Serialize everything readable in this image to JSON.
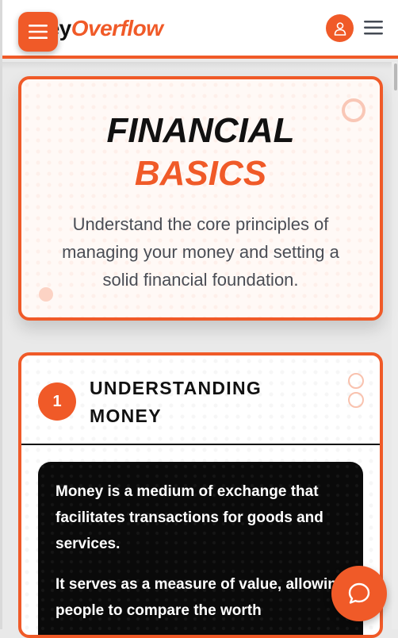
{
  "header": {
    "brand_part1": "ney",
    "brand_part2": "Overflow",
    "menu_button_icon": "hamburger-icon",
    "profile_icon": "user-icon",
    "nav_menu_icon": "hamburger-icon"
  },
  "hero": {
    "title_line1": "FINANCIAL",
    "title_line2": "BASICS",
    "description": "Understand the core principles of managing your money and setting a solid financial foundation."
  },
  "section": {
    "number": "1",
    "title": "UNDERSTANDING MONEY",
    "paragraphs": [
      "Money is a medium of exchange that facilitates transactions for goods and services.",
      "It serves as a measure of value, allowing people to compare the worth"
    ]
  },
  "chat": {
    "icon": "chat-bubble-icon"
  },
  "colors": {
    "accent": "#f05a28",
    "text_dark": "#111111",
    "text_muted": "#4a4d55",
    "content_bg": "#0a0a0a"
  }
}
